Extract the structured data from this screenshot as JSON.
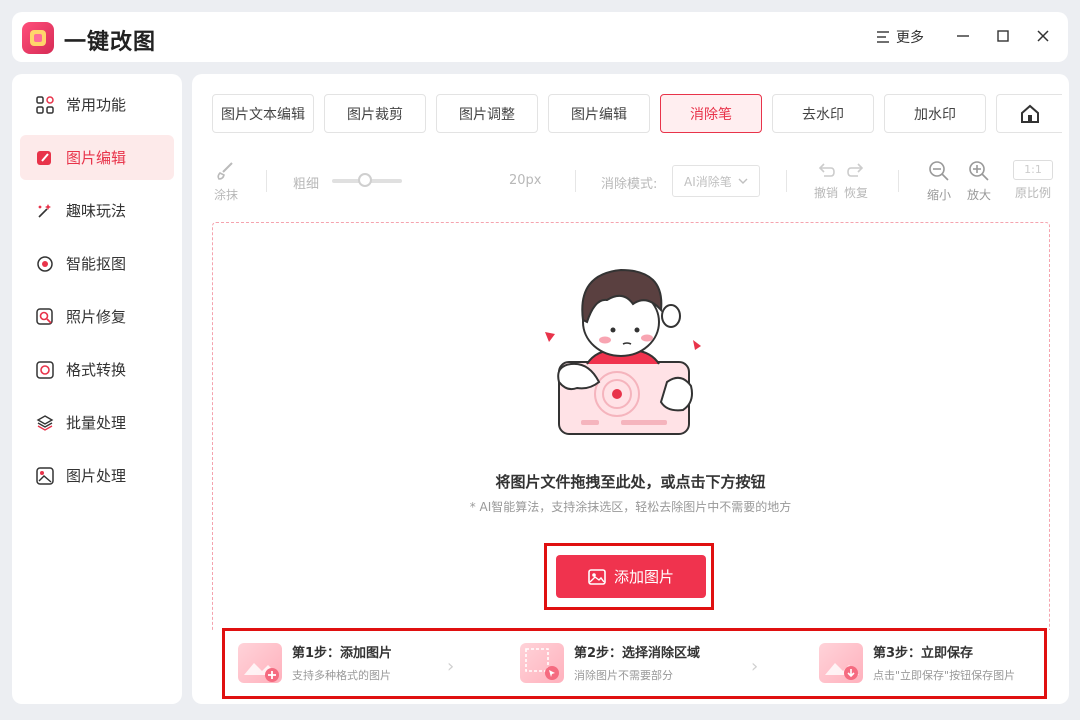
{
  "app": {
    "title": "一键改图",
    "more_label": "更多"
  },
  "sidebar": {
    "items": [
      {
        "label": "常用功能",
        "icon": "grid-icon"
      },
      {
        "label": "图片编辑",
        "icon": "edit-icon"
      },
      {
        "label": "趣味玩法",
        "icon": "magic-icon"
      },
      {
        "label": "智能抠图",
        "icon": "target-icon"
      },
      {
        "label": "照片修复",
        "icon": "repair-icon"
      },
      {
        "label": "格式转换",
        "icon": "convert-icon"
      },
      {
        "label": "批量处理",
        "icon": "layers-icon"
      },
      {
        "label": "图片处理",
        "icon": "image-icon"
      }
    ],
    "active_index": 1
  },
  "tabs": [
    "图片文本编辑",
    "图片裁剪",
    "图片调整",
    "图片编辑",
    "消除笔",
    "去水印",
    "加水印"
  ],
  "active_tab": 4,
  "toolbar": {
    "smear_label": "涂抹",
    "thickness_label": "粗细",
    "thickness_value": "20px",
    "mode_label": "消除模式:",
    "mode_value": "AI消除笔",
    "undo_label": "撤销",
    "redo_label": "恢复",
    "zoom_out_label": "缩小",
    "zoom_in_label": "放大",
    "ratio_box": "1:1",
    "original_label": "原比例"
  },
  "dropzone": {
    "title": "将图片文件拖拽至此处，或点击下方按钮",
    "subtitle": "* AI智能算法，支持涂抹选区，轻松去除图片中不需要的地方",
    "add_button": "添加图片"
  },
  "steps": [
    {
      "title": "第1步：添加图片",
      "desc": "支持多种格式的图片"
    },
    {
      "title": "第2步：选择消除区域",
      "desc": "消除图片不需要部分"
    },
    {
      "title": "第3步：立即保存",
      "desc": "点击\"立即保存\"按钮保存图片"
    }
  ],
  "colors": {
    "accent": "#f0334e",
    "highlight_frame": "#e01010"
  }
}
